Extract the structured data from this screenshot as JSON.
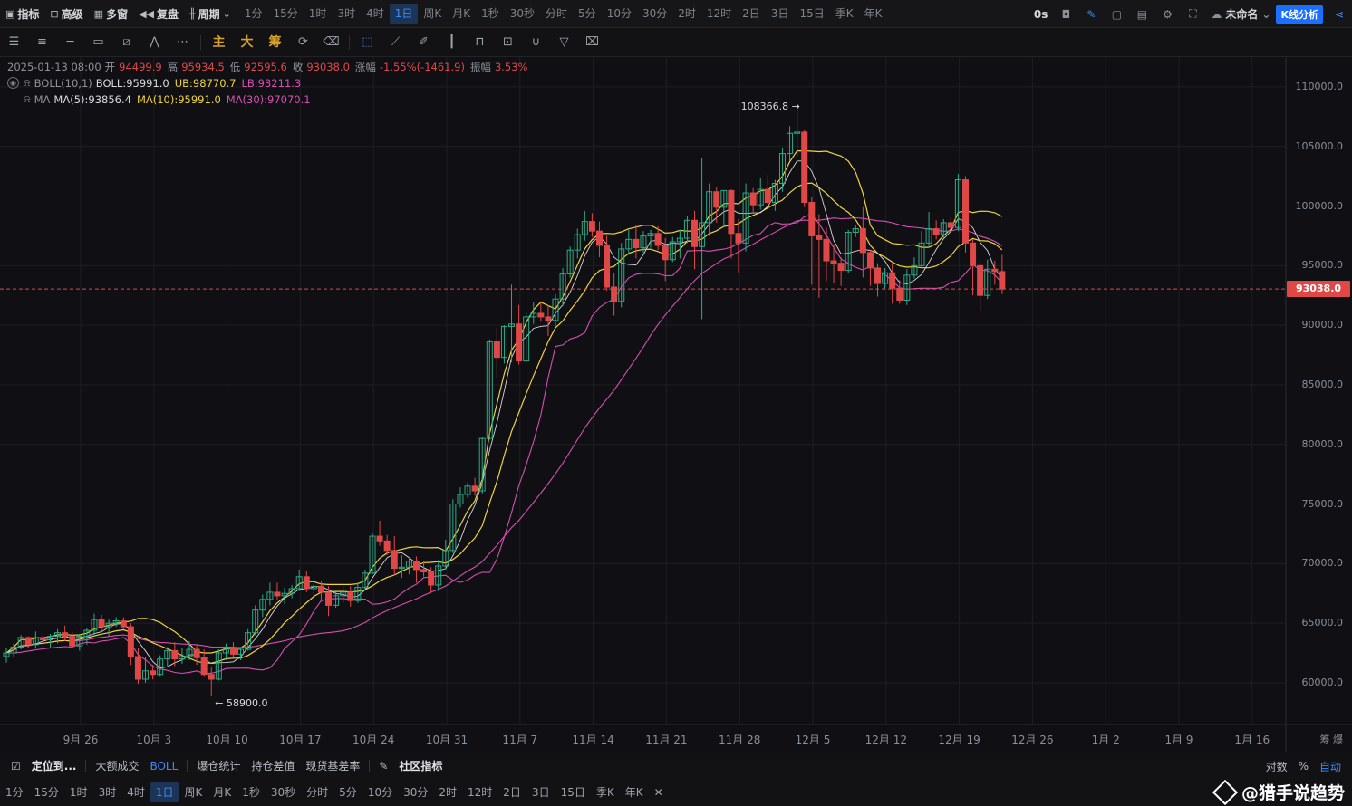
{
  "topbar": {
    "indicators": "指标",
    "advanced": "高级",
    "multi_window": "多窗",
    "replay": "复盘",
    "period": "周期",
    "periods": [
      "1分",
      "15分",
      "1时",
      "3时",
      "4时",
      "1日",
      "周K",
      "月K",
      "1秒",
      "30秒",
      "分时",
      "5分",
      "10分",
      "30分",
      "2时",
      "12时",
      "2日",
      "3日",
      "15日",
      "季K",
      "年K"
    ],
    "active_period": "1日",
    "countdown": "0s",
    "workspace": "未命名",
    "kline_analysis": "K线分析"
  },
  "toolbar2": {
    "main_label": "主",
    "big_label": "大",
    "chip_label": "筹"
  },
  "legend": {
    "date": "2025-01-13 08:00",
    "open_label": "开",
    "open": "94499.9",
    "high_label": "高",
    "high": "95934.5",
    "low_label": "低",
    "low": "92595.6",
    "close_label": "收",
    "close": "93038.0",
    "change_label": "涨幅",
    "change": "-1.55%(-1461.9)",
    "amp_label": "振幅",
    "amp": "3.53%",
    "boll_name": "BOLL(10,1)",
    "boll": "BOLL:95991.0",
    "ub": "UB:98770.7",
    "lb": "LB:93211.3",
    "ma_name": "MA",
    "ma5": "MA(5):93856.4",
    "ma10": "MA(10):95991.0",
    "ma30": "MA(30):97070.1"
  },
  "colors": {
    "up": "#2bab86",
    "down": "#e04848",
    "ma5": "#d8d8d8",
    "ma10": "#f0d43a",
    "ma30": "#d54fb3",
    "accent": "#3d8bff"
  },
  "chart_data": {
    "type": "candlestick",
    "current_price": "93038.0",
    "high_annotation": "108366.8",
    "low_annotation": "58900.0",
    "ylim": [
      56500,
      112500
    ],
    "y_ticks": [
      "110000.0",
      "105000.0",
      "100000.0",
      "95000.0",
      "90000.0",
      "85000.0",
      "80000.0",
      "75000.0",
      "70000.0",
      "65000.0",
      "60000.0"
    ],
    "x_ticks": [
      "9月 26",
      "10月 3",
      "10月 10",
      "10月 17",
      "10月 24",
      "10月 31",
      "11月 7",
      "11月 14",
      "11月 21",
      "11月 28",
      "12月 5",
      "12月 12",
      "12月 19",
      "12月 26",
      "1月 2",
      "1月 9",
      "1月 16"
    ],
    "series": [
      {
        "name": "MA(5)"
      },
      {
        "name": "MA(10)"
      },
      {
        "name": "MA(30)"
      },
      {
        "name": "UB"
      },
      {
        "name": "LB"
      }
    ],
    "candles": [
      [
        62200,
        62900,
        61700,
        62500
      ],
      [
        62500,
        63300,
        62100,
        63000
      ],
      [
        63000,
        64000,
        62800,
        63800
      ],
      [
        63800,
        63900,
        62900,
        63200
      ],
      [
        63200,
        64300,
        62900,
        63800
      ],
      [
        63800,
        64200,
        63000,
        63600
      ],
      [
        63600,
        64100,
        62900,
        63900
      ],
      [
        63900,
        64500,
        63300,
        64200
      ],
      [
        64200,
        64800,
        63500,
        63900
      ],
      [
        63900,
        64300,
        62900,
        63100
      ],
      [
        63100,
        64100,
        62700,
        63900
      ],
      [
        63900,
        64600,
        63200,
        64400
      ],
      [
        64400,
        65800,
        64000,
        65300
      ],
      [
        65300,
        65700,
        64300,
        64700
      ],
      [
        64700,
        65300,
        63900,
        65000
      ],
      [
        65000,
        65500,
        64700,
        65200
      ],
      [
        65200,
        65500,
        64500,
        64700
      ],
      [
        64700,
        65000,
        61500,
        62200
      ],
      [
        62200,
        62900,
        59900,
        60300
      ],
      [
        60300,
        62200,
        60000,
        61000
      ],
      [
        61000,
        61500,
        60300,
        60700
      ],
      [
        60700,
        62300,
        60500,
        62000
      ],
      [
        62000,
        63000,
        61400,
        62700
      ],
      [
        62700,
        63400,
        61400,
        62000
      ],
      [
        62000,
        62900,
        61600,
        62200
      ],
      [
        62200,
        63500,
        61900,
        62800
      ],
      [
        62800,
        63200,
        61500,
        62100
      ],
      [
        62100,
        62800,
        60500,
        60700
      ],
      [
        60700,
        61300,
        58900,
        60300
      ],
      [
        60300,
        62800,
        60200,
        62500
      ],
      [
        62500,
        63300,
        61900,
        62900
      ],
      [
        62900,
        63400,
        62100,
        62400
      ],
      [
        62400,
        63000,
        61900,
        62800
      ],
      [
        62800,
        64500,
        62700,
        64200
      ],
      [
        64200,
        66500,
        64000,
        66100
      ],
      [
        66100,
        67400,
        65500,
        67000
      ],
      [
        67000,
        68400,
        66500,
        67600
      ],
      [
        67600,
        68400,
        67000,
        67300
      ],
      [
        67300,
        68000,
        66600,
        67500
      ],
      [
        67500,
        68200,
        67100,
        67900
      ],
      [
        67900,
        69500,
        67700,
        68900
      ],
      [
        68900,
        69400,
        67600,
        67900
      ],
      [
        67900,
        68500,
        67300,
        68100
      ],
      [
        68100,
        68500,
        66800,
        67600
      ],
      [
        67600,
        68100,
        65600,
        66500
      ],
      [
        66500,
        67600,
        66300,
        67300
      ],
      [
        67300,
        68000,
        66700,
        67600
      ],
      [
        67600,
        68100,
        66400,
        66900
      ],
      [
        66900,
        68400,
        66700,
        68000
      ],
      [
        68000,
        69500,
        67800,
        69200
      ],
      [
        69200,
        72600,
        69100,
        72300
      ],
      [
        72300,
        73600,
        71500,
        71900
      ],
      [
        71900,
        72400,
        70700,
        71100
      ],
      [
        71100,
        72300,
        69000,
        69600
      ],
      [
        69600,
        70700,
        68800,
        69700
      ],
      [
        69700,
        70400,
        69100,
        70200
      ],
      [
        70200,
        70600,
        68400,
        69500
      ],
      [
        69500,
        70200,
        68900,
        69300
      ],
      [
        69300,
        69700,
        67500,
        68200
      ],
      [
        68200,
        70300,
        67700,
        69800
      ],
      [
        69800,
        72000,
        69500,
        71100
      ],
      [
        71100,
        75400,
        70900,
        75000
      ],
      [
        75000,
        76400,
        74700,
        75800
      ],
      [
        75800,
        76800,
        75500,
        76500
      ],
      [
        76500,
        77200,
        75700,
        76100
      ],
      [
        76100,
        80600,
        75800,
        80500
      ],
      [
        80500,
        88800,
        80400,
        88600
      ],
      [
        88600,
        89800,
        85600,
        87300
      ],
      [
        87300,
        90000,
        86800,
        89900
      ],
      [
        89900,
        93400,
        86900,
        90100
      ],
      [
        90100,
        91700,
        86700,
        87000
      ],
      [
        87000,
        91100,
        87000,
        90700
      ],
      [
        90700,
        91900,
        90100,
        91000
      ],
      [
        91000,
        92000,
        90300,
        90700
      ],
      [
        90700,
        91700,
        89100,
        90400
      ],
      [
        90400,
        92600,
        89900,
        92200
      ],
      [
        92200,
        94800,
        91600,
        94300
      ],
      [
        94300,
        96600,
        94000,
        96300
      ],
      [
        96300,
        98100,
        95600,
        97600
      ],
      [
        97600,
        99600,
        97100,
        98700
      ],
      [
        98700,
        99400,
        97400,
        97900
      ],
      [
        97900,
        98700,
        95700,
        96700
      ],
      [
        96700,
        97500,
        92900,
        93200
      ],
      [
        93200,
        94400,
        90800,
        92000
      ],
      [
        92000,
        96900,
        91500,
        96400
      ],
      [
        96400,
        98000,
        95900,
        97200
      ],
      [
        97200,
        98400,
        95600,
        96500
      ],
      [
        96500,
        97900,
        96100,
        97500
      ],
      [
        97500,
        98000,
        96500,
        97700
      ],
      [
        97700,
        98300,
        96300,
        96700
      ],
      [
        96700,
        97300,
        93700,
        95500
      ],
      [
        95500,
        97400,
        95300,
        97000
      ],
      [
        97000,
        98000,
        95600,
        97300
      ],
      [
        97300,
        99200,
        96900,
        98800
      ],
      [
        98800,
        99600,
        94700,
        96600
      ],
      [
        96600,
        104000,
        90500,
        98600
      ],
      [
        98600,
        101900,
        97500,
        101200
      ],
      [
        101200,
        101600,
        98600,
        99900
      ],
      [
        99900,
        101300,
        98200,
        101300
      ],
      [
        101300,
        101400,
        95600,
        97700
      ],
      [
        97700,
        98900,
        94400,
        96900
      ],
      [
        96900,
        101900,
        96200,
        101100
      ],
      [
        101100,
        101500,
        99500,
        100100
      ],
      [
        100100,
        102400,
        99700,
        101400
      ],
      [
        101400,
        102600,
        100200,
        100300
      ],
      [
        100300,
        102200,
        99600,
        101900
      ],
      [
        101900,
        104900,
        101200,
        104400
      ],
      [
        104400,
        106700,
        103800,
        106100
      ],
      [
        106100,
        108400,
        104200,
        106200
      ],
      [
        106200,
        106400,
        99900,
        100300
      ],
      [
        100300,
        100800,
        93400,
        97500
      ],
      [
        97500,
        99300,
        92300,
        97200
      ],
      [
        97200,
        98200,
        93700,
        95400
      ],
      [
        95400,
        96800,
        93500,
        95200
      ],
      [
        95200,
        95700,
        93300,
        94600
      ],
      [
        94600,
        98000,
        94400,
        97800
      ],
      [
        97800,
        98400,
        97400,
        98100
      ],
      [
        98100,
        99900,
        94000,
        96100
      ],
      [
        96100,
        96300,
        93300,
        94800
      ],
      [
        94800,
        95200,
        92400,
        93500
      ],
      [
        93500,
        94800,
        93000,
        94400
      ],
      [
        94400,
        95200,
        91800,
        93100
      ],
      [
        93100,
        93800,
        91800,
        92100
      ],
      [
        92100,
        94700,
        91700,
        94200
      ],
      [
        94200,
        95700,
        93900,
        95000
      ],
      [
        95000,
        97900,
        94800,
        96900
      ],
      [
        96900,
        99500,
        96500,
        98100
      ],
      [
        98100,
        98800,
        97200,
        97600
      ],
      [
        97600,
        98900,
        97300,
        98600
      ],
      [
        98600,
        99000,
        97700,
        98200
      ],
      [
        98200,
        102700,
        97900,
        102200
      ],
      [
        102200,
        102500,
        96100,
        96900
      ],
      [
        96900,
        97200,
        92500,
        95000
      ],
      [
        95000,
        95300,
        91200,
        92500
      ],
      [
        92500,
        95500,
        92200,
        94700
      ],
      [
        94700,
        95400,
        93400,
        94500
      ],
      [
        94500,
        95900,
        92600,
        93038
      ]
    ]
  },
  "panelbar": {
    "locate": "定位到...",
    "big_trades": "大额成交",
    "boll": "BOLL",
    "liq_stats": "爆仓统计",
    "oi_diff": "持仓差值",
    "basis": "现货基差率",
    "community": "社区指标",
    "log": "对数",
    "percent": "%",
    "auto": "自动",
    "x_axis_right": "筹 爆"
  },
  "bottombar": {
    "periods": [
      "1分",
      "15分",
      "1时",
      "3时",
      "4时",
      "1日",
      "周K",
      "月K",
      "1秒",
      "30秒",
      "分时",
      "5分",
      "10分",
      "30分",
      "2时",
      "12时",
      "2日",
      "3日",
      "15日",
      "季K",
      "年K"
    ],
    "active": "1日",
    "close": "✕"
  },
  "watermark": "@猎手说趋势"
}
